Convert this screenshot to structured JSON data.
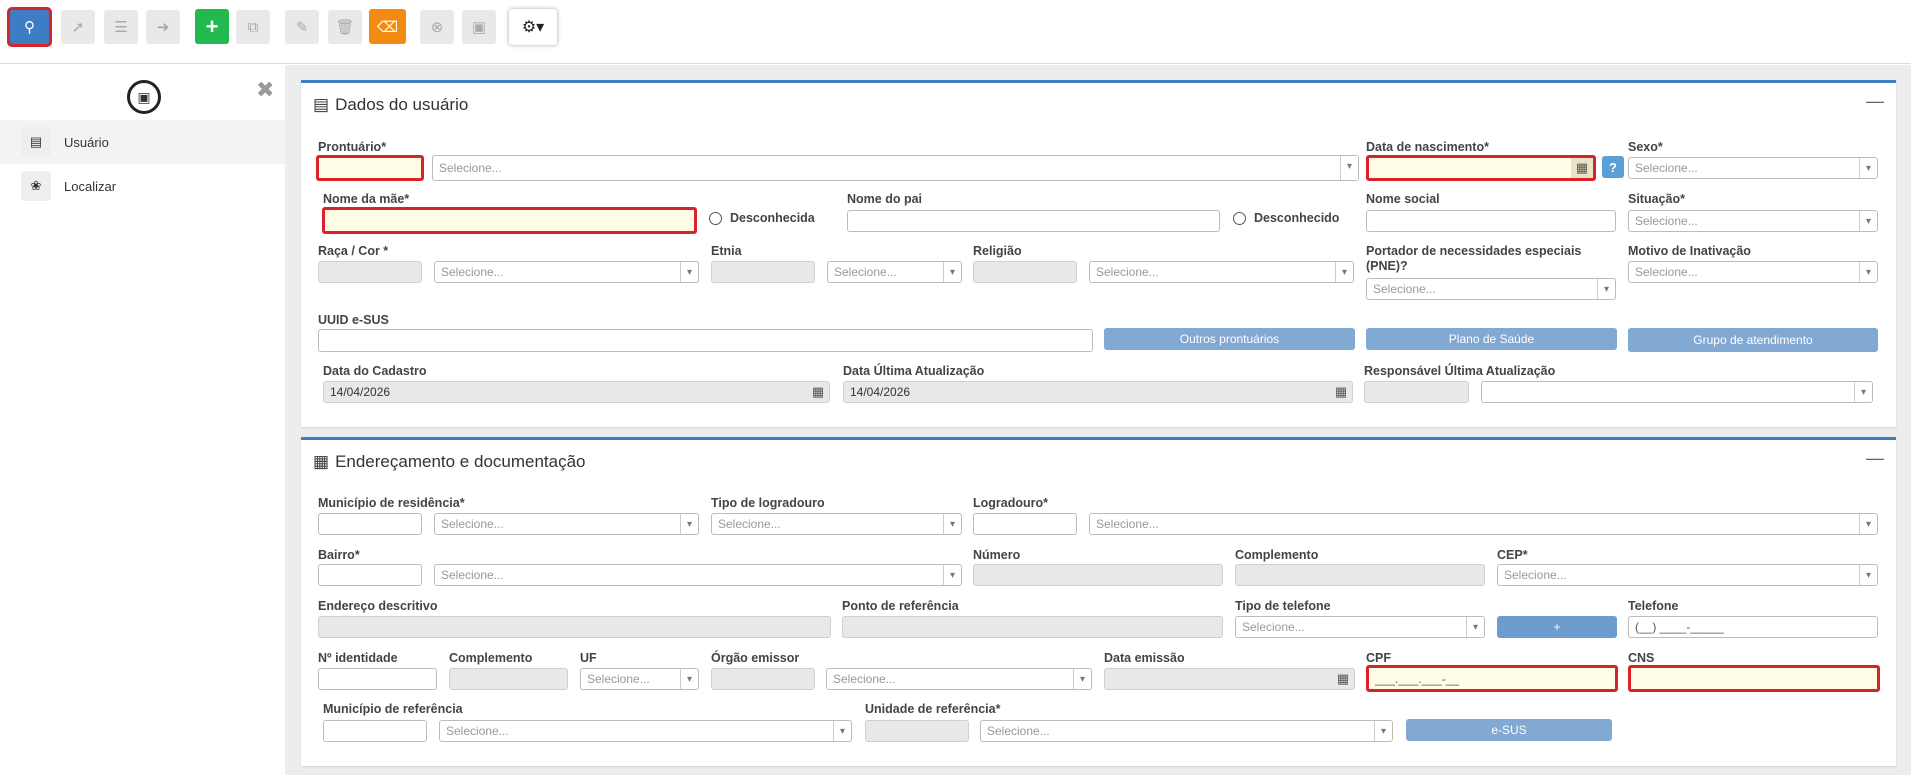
{
  "sidebar": {
    "items": [
      {
        "label": "Usuário"
      },
      {
        "label": "Localizar"
      }
    ]
  },
  "panel1": {
    "title": "Dados do usuário",
    "prontuario_label": "Prontuário*",
    "prontuario_select": "Selecione...",
    "data_nasc_label": "Data de nascimento*",
    "help_label": "?",
    "sexo_label": "Sexo*",
    "sexo_select": "Selecione...",
    "nome_mae_label": "Nome da mãe*",
    "desconhecida_label": "Desconhecida",
    "nome_pai_label": "Nome do pai",
    "desconhecido_label": "Desconhecido",
    "nome_social_label": "Nome social",
    "situacao_label": "Situação*",
    "situacao_select": "Selecione...",
    "raca_label": "Raça / Cor *",
    "raca_select": "Selecione...",
    "etnia_label": "Etnia",
    "etnia_select": "Selecione...",
    "religiao_label": "Religião",
    "religiao_select": "Selecione...",
    "pne_label": "Portador de necessidades especiais (PNE)?",
    "pne_select": "Selecione...",
    "motivo_label": "Motivo de Inativação",
    "motivo_select": "Selecione...",
    "uuid_label": "UUID e-SUS",
    "outros_btn": "Outros prontuários",
    "plano_btn": "Plano de Saúde",
    "grupo_btn": "Grupo de atendimento",
    "data_cadastro_label": "Data do Cadastro",
    "data_cadastro_value": "14/04/2026",
    "data_atual_label": "Data Última Atualização",
    "data_atual_value": "14/04/2026",
    "responsavel_label": "Responsável Última Atualização"
  },
  "panel2": {
    "title": "Endereçamento e documentação",
    "municipio_label": "Município de residência*",
    "municipio_select": "Selecione...",
    "tipo_log_label": "Tipo de logradouro",
    "tipo_log_select": "Selecione...",
    "logradouro_label": "Logradouro*",
    "logradouro_select": "Selecione...",
    "bairro_label": "Bairro*",
    "bairro_select": "Selecione...",
    "numero_label": "Número",
    "complemento_label": "Complemento",
    "cep_label": "CEP*",
    "cep_select": "Selecione...",
    "end_desc_label": "Endereço descritivo",
    "ponto_label": "Ponto de referência",
    "tipo_tel_label": "Tipo de telefone",
    "tipo_tel_select": "Selecione...",
    "add_tel_btn": "+",
    "telefone_label": "Telefone",
    "telefone_placeholder": "(__) ____-_____",
    "identidade_label": "Nº identidade",
    "complemento2_label": "Complemento",
    "uf_label": "UF",
    "uf_select": "Selecione...",
    "orgao_label": "Órgão emissor",
    "orgao_select": "Selecione...",
    "data_emissao_label": "Data emissão",
    "cpf_label": "CPF",
    "cpf_placeholder": "___.___.___-__",
    "cns_label": "CNS",
    "mun_ref_label": "Município de referência",
    "mun_ref_select": "Selecione...",
    "unidade_label": "Unidade de referência*",
    "unidade_select": "Selecione...",
    "esus_btn": "e-SUS"
  }
}
